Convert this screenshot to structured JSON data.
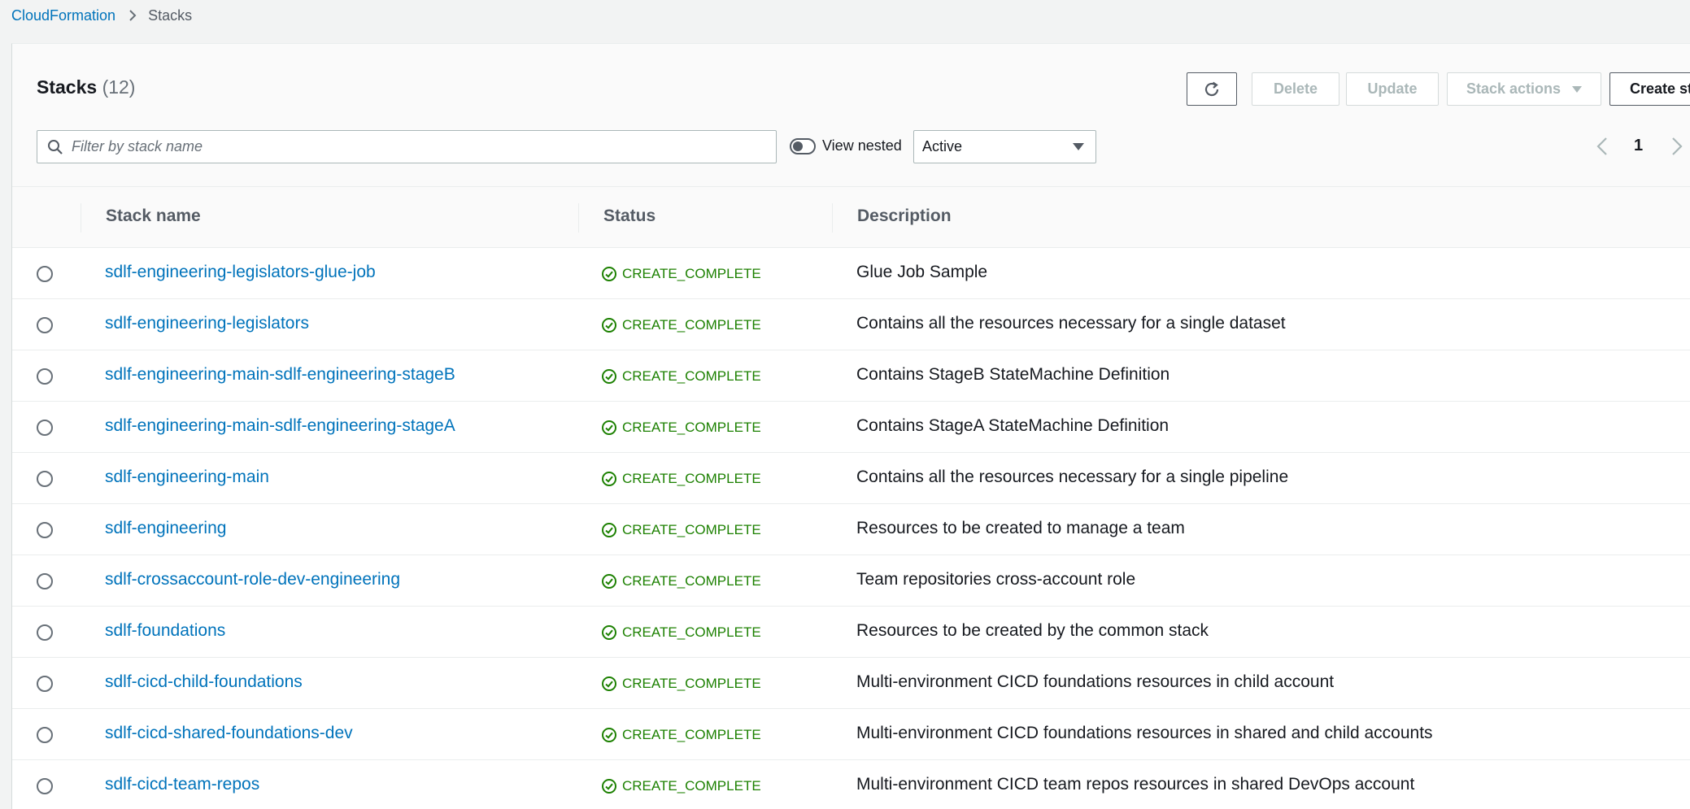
{
  "breadcrumb": {
    "root": "CloudFormation",
    "current": "Stacks"
  },
  "header": {
    "title": "Stacks",
    "count": "(12)"
  },
  "toolbar": {
    "delete_label": "Delete",
    "update_label": "Update",
    "stack_actions_label": "Stack actions",
    "create_label": "Create stac"
  },
  "filter": {
    "placeholder": "Filter by stack name",
    "value": ""
  },
  "view_nested": {
    "label": "View nested",
    "enabled": false
  },
  "status_select": {
    "value": "Active"
  },
  "pagination": {
    "page": "1"
  },
  "table": {
    "columns": [
      "Stack name",
      "Status",
      "Description"
    ],
    "rows": [
      {
        "name": "sdlf-engineering-legislators-glue-job",
        "status": "CREATE_COMPLETE",
        "description": "Glue Job Sample"
      },
      {
        "name": "sdlf-engineering-legislators",
        "status": "CREATE_COMPLETE",
        "description": "Contains all the resources necessary for a single dataset"
      },
      {
        "name": "sdlf-engineering-main-sdlf-engineering-stageB",
        "status": "CREATE_COMPLETE",
        "description": "Contains StageB StateMachine Definition"
      },
      {
        "name": "sdlf-engineering-main-sdlf-engineering-stageA",
        "status": "CREATE_COMPLETE",
        "description": "Contains StageA StateMachine Definition"
      },
      {
        "name": "sdlf-engineering-main",
        "status": "CREATE_COMPLETE",
        "description": "Contains all the resources necessary for a single pipeline"
      },
      {
        "name": "sdlf-engineering",
        "status": "CREATE_COMPLETE",
        "description": "Resources to be created to manage a team"
      },
      {
        "name": "sdlf-crossaccount-role-dev-engineering",
        "status": "CREATE_COMPLETE",
        "description": "Team repositories cross-account role"
      },
      {
        "name": "sdlf-foundations",
        "status": "CREATE_COMPLETE",
        "description": "Resources to be created by the common stack"
      },
      {
        "name": "sdlf-cicd-child-foundations",
        "status": "CREATE_COMPLETE",
        "description": "Multi-environment CICD foundations resources in child account"
      },
      {
        "name": "sdlf-cicd-shared-foundations-dev",
        "status": "CREATE_COMPLETE",
        "description": "Multi-environment CICD foundations resources in shared and child accounts"
      },
      {
        "name": "sdlf-cicd-team-repos",
        "status": "CREATE_COMPLETE",
        "description": "Multi-environment CICD team repos resources in shared DevOps account"
      }
    ]
  },
  "icons": {
    "breadcrumb_separator": "chevron-right-icon",
    "refresh": "refresh-icon",
    "search": "search-icon",
    "dropdown": "caret-down-icon",
    "pager_prev": "chevron-left-icon",
    "pager_next": "chevron-right-icon",
    "status": "check-circle-icon"
  },
  "colors": {
    "link": "#0073bb",
    "success": "#1d8102",
    "disabled": "#aab7b8",
    "background": "#f2f3f3"
  }
}
